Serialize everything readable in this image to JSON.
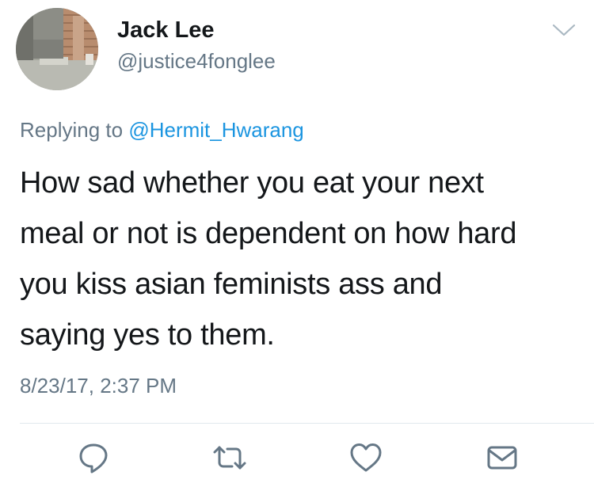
{
  "tweet": {
    "display_name": "Jack Lee",
    "handle": "@justice4fonglee",
    "replying_prefix": "Replying to",
    "reply_target": "@Hermit_Hwarang",
    "lines": [
      "How sad whether you eat your next",
      "meal or not is dependent on how hard",
      "you kiss asian feminists ass and",
      "saying yes to them."
    ],
    "timestamp": "8/23/17, 2:37 PM"
  },
  "actions": {
    "reply": "reply-icon",
    "retweet": "retweet-icon",
    "like": "heart-icon",
    "message": "envelope-icon"
  },
  "colors": {
    "text": "#14171a",
    "secondary": "#657786",
    "link": "#1b95e0",
    "icon": "#657786",
    "divider": "#e1e8ed"
  }
}
